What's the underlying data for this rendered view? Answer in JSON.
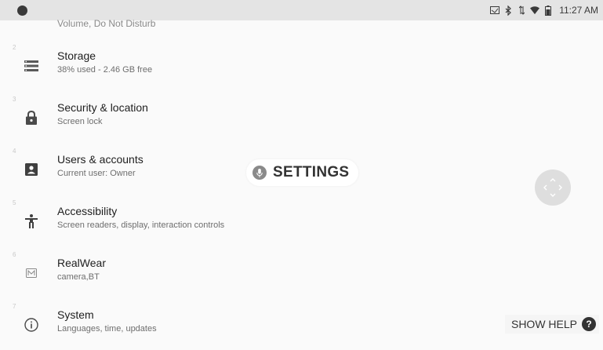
{
  "status_bar": {
    "time": "11:27 AM",
    "icons": [
      "cast-icon",
      "bluetooth-icon",
      "data-arrows-icon",
      "wifi-icon",
      "battery-icon"
    ]
  },
  "list": {
    "top_partial_text": "Volume, Do Not Disturb",
    "items": [
      {
        "index": "2",
        "icon": "storage-icon",
        "title": "Storage",
        "subtitle": "38% used - 2.46 GB free"
      },
      {
        "index": "3",
        "icon": "lock-icon",
        "title": "Security & location",
        "subtitle": "Screen lock"
      },
      {
        "index": "4",
        "icon": "account-box-icon",
        "title": "Users & accounts",
        "subtitle": "Current user: Owner"
      },
      {
        "index": "5",
        "icon": "accessibility-icon",
        "title": "Accessibility",
        "subtitle": "Screen readers, display, interaction controls"
      },
      {
        "index": "6",
        "icon": "realwear-icon",
        "title": "RealWear",
        "subtitle": "camera,BT"
      },
      {
        "index": "7",
        "icon": "info-icon",
        "title": "System",
        "subtitle": "Languages, time, updates"
      }
    ]
  },
  "voice_overlay": {
    "label": "SETTINGS",
    "icon": "mic-icon"
  },
  "help": {
    "label": "SHOW HELP",
    "icon": "question-icon"
  },
  "colors": {
    "status_bar": "#e4e4e4",
    "background": "#fafafa",
    "icon": "#5a5a5a"
  }
}
